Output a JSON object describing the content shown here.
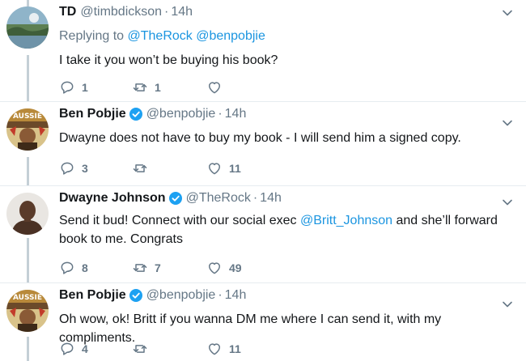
{
  "tweets": [
    {
      "name": "TD",
      "handle": "@timbdickson",
      "time": "14h",
      "verified": false,
      "replying": {
        "prefix": "Replying to",
        "mentions": [
          "@TheRock",
          "@benpobjie"
        ]
      },
      "text_line1": "I take it you won’t be buying his book?",
      "reply_count": "1",
      "retweet_count": "1",
      "like_count": ""
    },
    {
      "name": "Ben Pobjie",
      "handle": "@benpobjie",
      "time": "14h",
      "verified": true,
      "text_line1": "Dwayne does not have to buy my book - I will send him a signed copy.",
      "reply_count": "3",
      "retweet_count": "",
      "like_count": "11"
    },
    {
      "name": "Dwayne Johnson",
      "handle": "@TheRock",
      "time": "14h",
      "verified": true,
      "text_line1_a": "Send it bud! Connect with our social exec ",
      "text_line1_mention": "@Britt_Johnson",
      "text_line1_b": " and she’ll forward",
      "text_line2": "book to me. Congrats",
      "reply_count": "8",
      "retweet_count": "7",
      "like_count": "49"
    },
    {
      "name": "Ben Pobjie",
      "handle": "@benpobjie",
      "time": "14h",
      "verified": true,
      "text_line1": "Oh wow, ok! Britt if you wanna DM me where I can send it, with my compliments.",
      "reply_count": "4",
      "retweet_count": "",
      "like_count": "11"
    }
  ],
  "separator": "·",
  "colors": {
    "link": "#1b95e0",
    "verified": "#1da1f2",
    "muted": "#657786",
    "rail": "#c4cfd6"
  }
}
